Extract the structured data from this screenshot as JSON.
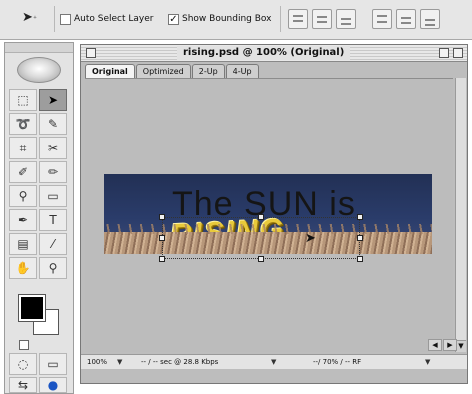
{
  "options_bar": {
    "tool_icon": "move-tool-icon",
    "auto_select_layer": {
      "label": "Auto Select Layer",
      "checked": false
    },
    "show_bounding_box": {
      "label": "Show Bounding Box",
      "checked": true
    },
    "align_buttons": [
      "align-top",
      "align-vcenter",
      "align-bottom",
      "align-left",
      "align-hcenter",
      "align-right"
    ]
  },
  "toolbox": {
    "tools": [
      "marquee-tool-icon",
      "move-tool-icon",
      "lasso-tool-icon",
      "magic-wand-tool-icon",
      "crop-tool-icon",
      "slice-tool-icon",
      "brush-tool-icon",
      "pencil-tool-icon",
      "stamp-tool-icon",
      "eraser-tool-icon",
      "pen-tool-icon",
      "type-tool-icon",
      "notes-tool-icon",
      "eyedropper-tool-icon",
      "hand-tool-icon",
      "zoom-tool-icon"
    ],
    "type_tool_glyph": "T",
    "foreground_color": "#000000",
    "background_color": "#ffffff"
  },
  "document": {
    "title": "rising.psd @ 100% (Original)",
    "tabs": [
      "Original",
      "Optimized",
      "2-Up",
      "4-Up"
    ],
    "active_tab": "Original",
    "canvas": {
      "headline": "The SUN is",
      "subline": "RISING"
    },
    "status": {
      "zoom": "100%",
      "size_info": "-- / -- sec @ 28.8 Kbps",
      "color_info": "--/ 70% / -- RF"
    }
  }
}
